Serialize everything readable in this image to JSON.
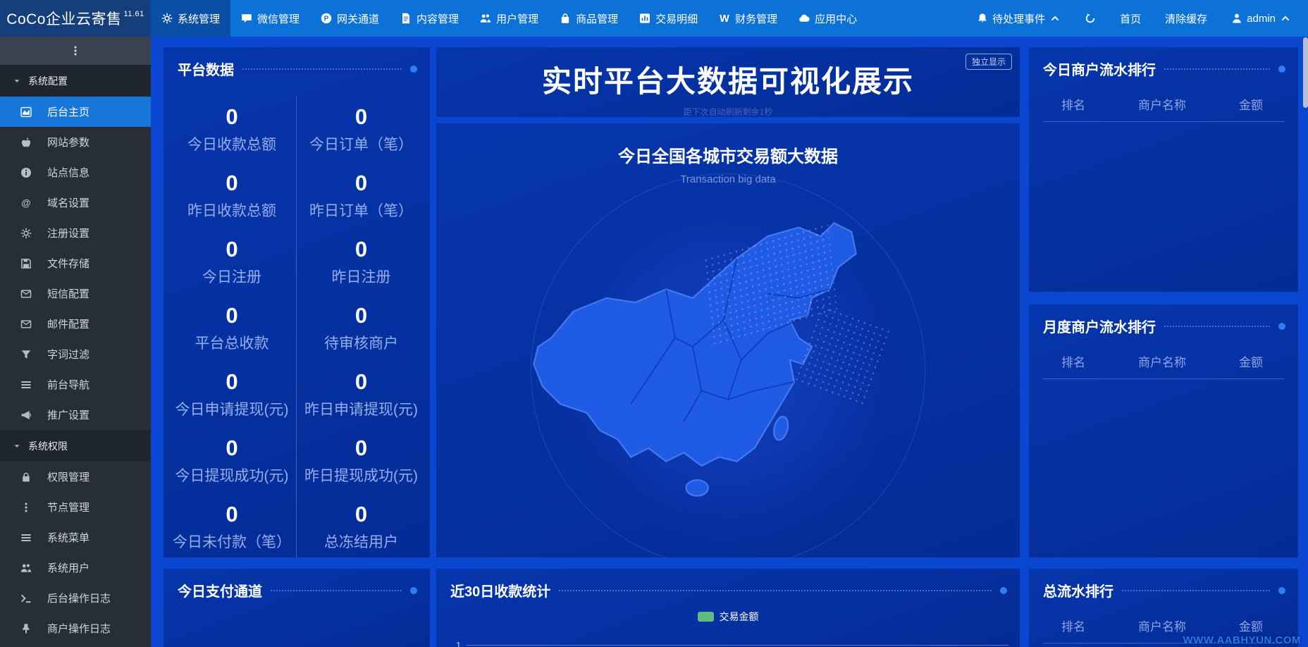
{
  "topbar": {
    "logo": "CoCo企业云寄售",
    "version": "11.61",
    "menus": [
      {
        "label": "系统管理",
        "icon": "gear-icon",
        "active": true
      },
      {
        "label": "微信管理",
        "icon": "wechat-icon",
        "active": false
      },
      {
        "label": "网关通道",
        "icon": "gateway-p-icon",
        "active": false
      },
      {
        "label": "内容管理",
        "icon": "document-icon",
        "active": false
      },
      {
        "label": "用户管理",
        "icon": "users-icon",
        "active": false
      },
      {
        "label": "商品管理",
        "icon": "bag-icon",
        "active": false
      },
      {
        "label": "交易明细",
        "icon": "bar-chart-icon",
        "active": false
      },
      {
        "label": "财务管理",
        "icon": "finance-w-icon",
        "active": false
      },
      {
        "label": "应用中心",
        "icon": "cloud-icon",
        "active": false
      }
    ],
    "pending_events": "待处理事件",
    "home": "首页",
    "clear_cache": "清除缓存",
    "user": "admin"
  },
  "sidebar": {
    "sections": [
      {
        "title": "系统配置",
        "items": [
          {
            "label": "后台主页",
            "icon": "area-chart-icon",
            "active": true
          },
          {
            "label": "网站参数",
            "icon": "apple-icon",
            "active": false
          },
          {
            "label": "站点信息",
            "icon": "info-icon",
            "active": false
          },
          {
            "label": "域名设置",
            "icon": "at-icon",
            "active": false
          },
          {
            "label": "注册设置",
            "icon": "gear-icon",
            "active": false
          },
          {
            "label": "文件存储",
            "icon": "floppy-icon",
            "active": false
          },
          {
            "label": "短信配置",
            "icon": "envelope-icon",
            "active": false
          },
          {
            "label": "邮件配置",
            "icon": "envelope-icon",
            "active": false
          },
          {
            "label": "字词过滤",
            "icon": "filter-icon",
            "active": false
          },
          {
            "label": "前台导航",
            "icon": "list-icon",
            "active": false
          },
          {
            "label": "推广设置",
            "icon": "megaphone-icon",
            "active": false
          }
        ]
      },
      {
        "title": "系统权限",
        "items": [
          {
            "label": "权限管理",
            "icon": "lock-icon",
            "active": false
          },
          {
            "label": "节点管理",
            "icon": "vertical-dots-icon",
            "active": false
          },
          {
            "label": "系统菜单",
            "icon": "menu-icon",
            "active": false
          },
          {
            "label": "系统用户",
            "icon": "users-icon",
            "active": false
          },
          {
            "label": "后台操作日志",
            "icon": "terminal-icon",
            "active": false
          },
          {
            "label": "商户操作日志",
            "icon": "pin-icon",
            "active": false
          }
        ]
      }
    ]
  },
  "stats": {
    "title": "平台数据",
    "items": [
      {
        "value": "0",
        "label": "今日收款总额"
      },
      {
        "value": "0",
        "label": "今日订单（笔）"
      },
      {
        "value": "0",
        "label": "昨日收款总额"
      },
      {
        "value": "0",
        "label": "昨日订单（笔）"
      },
      {
        "value": "0",
        "label": "今日注册"
      },
      {
        "value": "0",
        "label": "昨日注册"
      },
      {
        "value": "0",
        "label": "平台总收款"
      },
      {
        "value": "0",
        "label": "待审核商户"
      },
      {
        "value": "0",
        "label": "今日申请提现(元)"
      },
      {
        "value": "0",
        "label": "昨日申请提现(元)"
      },
      {
        "value": "0",
        "label": "今日提现成功(元)"
      },
      {
        "value": "0",
        "label": "昨日提现成功(元)"
      },
      {
        "value": "0",
        "label": "今日未付款（笔）"
      },
      {
        "value": "0",
        "label": "总冻结用户"
      }
    ]
  },
  "billboard": {
    "title": "实时平台大数据可视化展示",
    "refresh_note": "距下次自动刷新剩余1秒",
    "standalone_button": "独立显示"
  },
  "map_panel": {
    "title": "今日全国各城市交易额大数据",
    "subtitle": "Transaction big data"
  },
  "rank": {
    "today": {
      "title": "今日商户流水排行",
      "cols": [
        "排名",
        "商户名称",
        "金额"
      ]
    },
    "monthly": {
      "title": "月度商户流水排行",
      "cols": [
        "排名",
        "商户名称",
        "金额"
      ]
    },
    "total": {
      "title": "总流水排行",
      "cols": [
        "排名",
        "商户名称",
        "金额"
      ]
    }
  },
  "payment_panel": {
    "title": "今日支付通道"
  },
  "chart_panel": {
    "title": "近30日收款统计",
    "legend": "交易金额",
    "legend_color": "#5fbe7d",
    "y_tick": "1"
  },
  "watermark": "WWW.AABHYUN.COM",
  "colors": {
    "topbar": "#0d72d8",
    "logo_bg": "#143e7c",
    "page_bg": "#0a46d0",
    "panel_bg": "#05309e",
    "sidebar_bg": "#272e38",
    "active_blue": "#1677d9",
    "map_fill": "#1f5be4",
    "legend_green": "#5fbe7d",
    "watermark_blue": "#1a7cff"
  }
}
